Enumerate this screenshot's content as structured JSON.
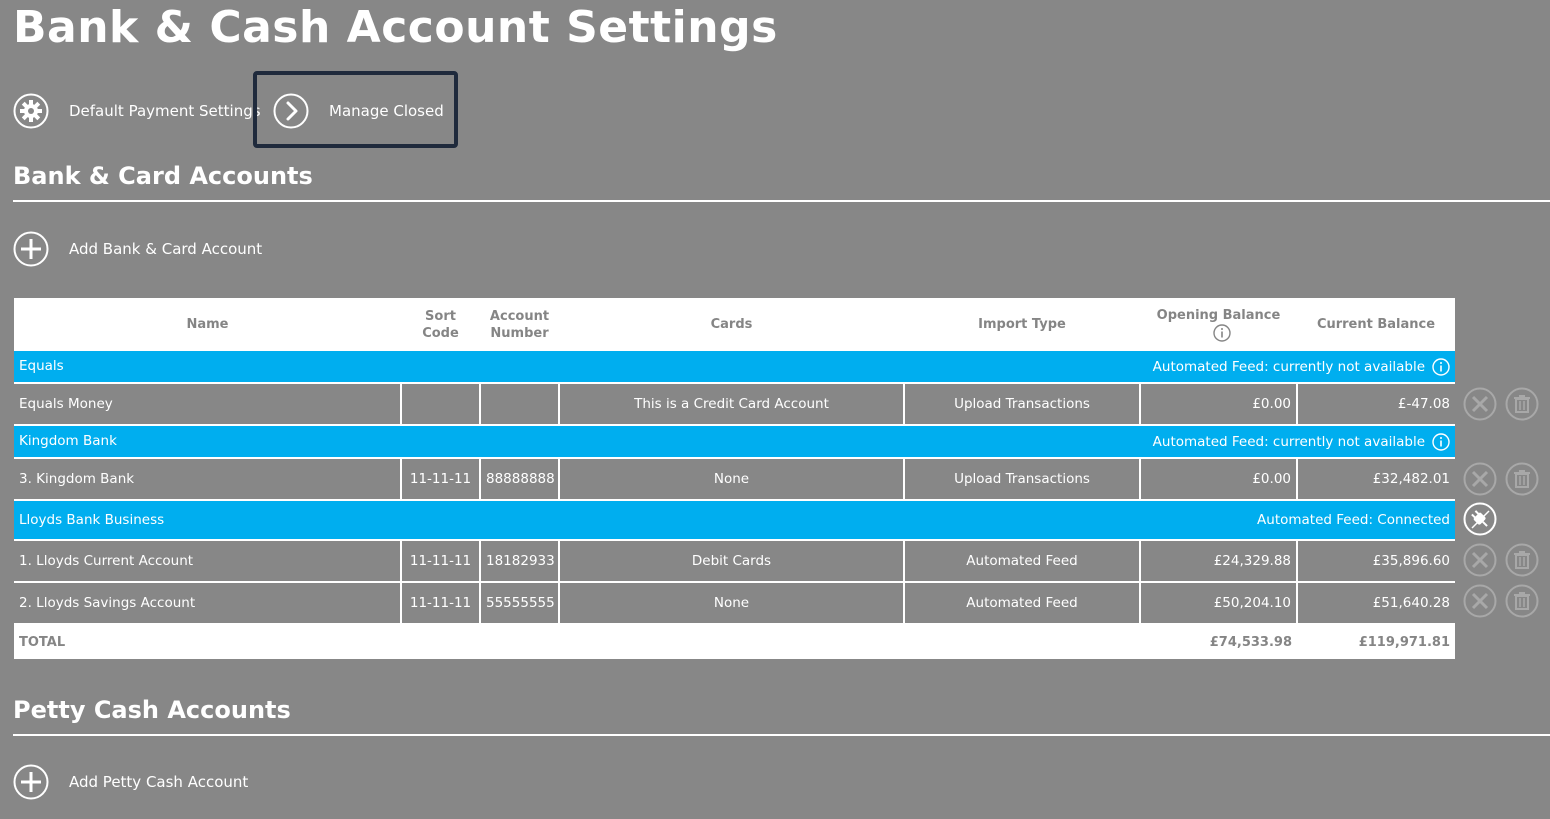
{
  "page": {
    "title": "Bank & Cash Account Settings"
  },
  "actions": {
    "default_payment": "Default Payment Settings",
    "manage_closed": "Manage Closed"
  },
  "bank_section": {
    "title": "Bank & Card Accounts",
    "add_label": "Add Bank & Card Account"
  },
  "table": {
    "headers": {
      "name": "Name",
      "sort_code": "Sort Code",
      "account_number": "Account Number",
      "cards": "Cards",
      "import_type": "Import Type",
      "opening_balance": "Opening Balance",
      "current_balance": "Current Balance"
    },
    "groups": [
      {
        "name": "Equals",
        "feed_status": "Automated Feed: currently not available",
        "rows": [
          {
            "name": "Equals Money",
            "sort_code": "",
            "account_number": "",
            "cards": "This is a Credit Card Account",
            "import_type": "Upload Transactions",
            "opening_balance": "£0.00",
            "current_balance": "£-47.08"
          }
        ]
      },
      {
        "name": "Kingdom Bank",
        "feed_status": "Automated Feed: currently not available",
        "rows": [
          {
            "name": "3. Kingdom Bank",
            "sort_code": "11-11-11",
            "account_number": "88888888",
            "cards": "None",
            "import_type": "Upload Transactions",
            "opening_balance": "£0.00",
            "current_balance": "£32,482.01"
          }
        ]
      },
      {
        "name": "Lloyds Bank Business",
        "feed_status": "Automated Feed: Connected",
        "rows": [
          {
            "name": "1. Lloyds Current Account",
            "sort_code": "11-11-11",
            "account_number": "18182933",
            "cards": "Debit Cards",
            "import_type": "Automated Feed",
            "opening_balance": "£24,329.88",
            "current_balance": "£35,896.60"
          },
          {
            "name": "2. Lloyds Savings Account",
            "sort_code": "11-11-11",
            "account_number": "55555555",
            "cards": "None",
            "import_type": "Automated Feed",
            "opening_balance": "£50,204.10",
            "current_balance": "£51,640.28"
          }
        ]
      }
    ],
    "total": {
      "label": "TOTAL",
      "opening_balance": "£74,533.98",
      "current_balance": "£119,971.81"
    }
  },
  "petty_section": {
    "title": "Petty Cash Accounts",
    "add_label": "Add Petty Cash Account"
  },
  "colors": {
    "background": "#878787",
    "group_row": "#00aeef",
    "highlight_border": "#1f2a3c"
  },
  "icons": [
    "gear-icon",
    "chevron-right-icon",
    "plus-circle-icon",
    "info-icon",
    "close-circle-icon",
    "trash-icon",
    "plug-icon"
  ]
}
